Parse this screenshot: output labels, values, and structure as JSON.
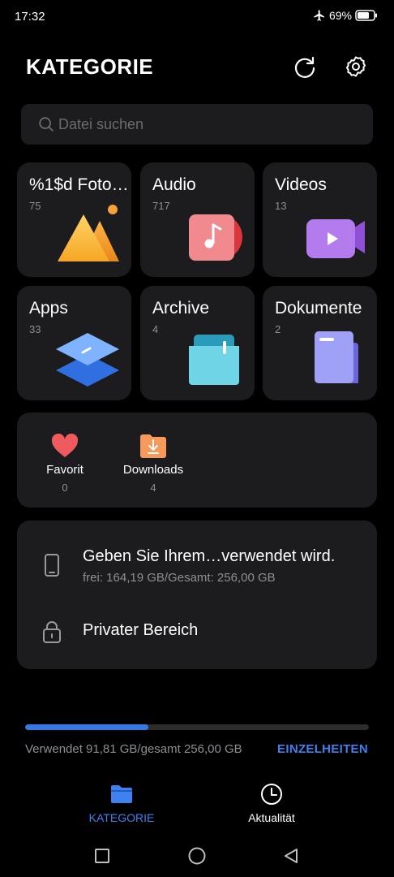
{
  "status_bar": {
    "time": "17:32",
    "battery": "69%",
    "icons": [
      "airplane-icon",
      "battery-icon"
    ]
  },
  "header": {
    "title": "KATEGORIE",
    "refresh_icon": "refresh-icon",
    "settings_icon": "gear-icon"
  },
  "search": {
    "placeholder": "Datei suchen",
    "icon": "search-icon"
  },
  "categories": [
    {
      "label": "%1$d Foto…",
      "count": "75",
      "icon": "photo-icon"
    },
    {
      "label": "Audio",
      "count": "717",
      "icon": "music-icon"
    },
    {
      "label": "Videos",
      "count": "13",
      "icon": "video-icon"
    },
    {
      "label": "Apps",
      "count": "33",
      "icon": "apps-icon"
    },
    {
      "label": "Archive",
      "count": "4",
      "icon": "archive-icon"
    },
    {
      "label": "Dokumente",
      "count": "2",
      "icon": "document-icon"
    }
  ],
  "quick_access": [
    {
      "label": "Favorit",
      "count": "0",
      "icon": "heart-icon"
    },
    {
      "label": "Downloads",
      "count": "4",
      "icon": "download-folder-icon"
    }
  ],
  "storage": {
    "device_title": "Geben Sie Ihrem…verwendet wird.",
    "device_subtitle": "frei: 164,19 GB/Gesamt: 256,00 GB",
    "private_title": "Privater Bereich",
    "device_icon": "phone-icon",
    "private_icon": "lock-icon"
  },
  "usage": {
    "text": "Verwendet 91,81 GB/gesamt 256,00 GB",
    "used_fraction": 0.3586,
    "details_label": "EINZELHEITEN"
  },
  "bottom_nav": [
    {
      "label": "KATEGORIE",
      "icon": "folder-icon",
      "active": true
    },
    {
      "label": "Aktualität",
      "icon": "clock-icon",
      "active": false
    }
  ],
  "colors": {
    "accent": "#3d82f0",
    "card_bg": "#1c1c1e",
    "background": "#000000"
  }
}
